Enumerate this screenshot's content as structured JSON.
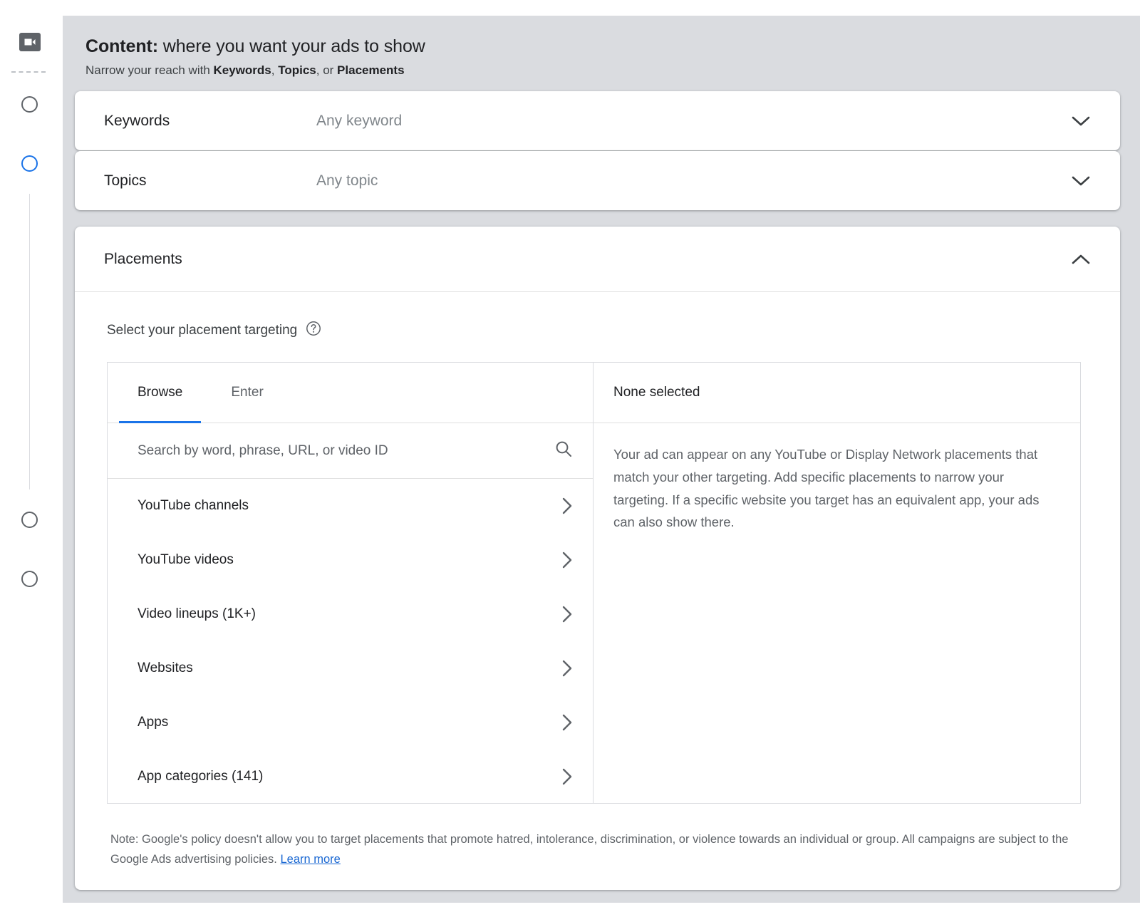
{
  "rail": {
    "brand_icon": "video-camera-icon",
    "steps": [
      {
        "name": "step-1",
        "state": "inactive"
      },
      {
        "name": "step-2",
        "state": "active"
      },
      {
        "name": "step-3",
        "state": "inactive"
      },
      {
        "name": "step-4",
        "state": "inactive"
      }
    ],
    "active_color": "#1a73e8",
    "inactive_color": "#5f6368"
  },
  "section": {
    "title_bold": "Content:",
    "title_rest": " where you want your ads to show",
    "subtitle_prefix": "Narrow your reach with ",
    "subtitle_b1": "Keywords",
    "subtitle_sep1": ", ",
    "subtitle_b2": "Topics",
    "subtitle_sep2": ", or ",
    "subtitle_b3": "Placements"
  },
  "cards": {
    "keywords": {
      "label": "Keywords",
      "value": "Any keyword",
      "chevron": "chevron-down-icon"
    },
    "topics": {
      "label": "Topics",
      "value": "Any topic",
      "chevron": "chevron-down-icon"
    },
    "placements": {
      "label": "Placements",
      "chevron": "chevron-up-icon"
    }
  },
  "placements": {
    "select_label": "Select your placement targeting",
    "help_icon": "help-circle-icon",
    "tabs": [
      {
        "label": "Browse",
        "active": true
      },
      {
        "label": "Enter",
        "active": false
      }
    ],
    "search": {
      "placeholder": "Search by word, phrase, URL, or video ID",
      "value": "",
      "icon": "search-icon"
    },
    "browse_items": [
      {
        "label": "YouTube channels"
      },
      {
        "label": "YouTube videos"
      },
      {
        "label": "Video lineups (1K+)"
      },
      {
        "label": "Websites"
      },
      {
        "label": "Apps"
      },
      {
        "label": "App categories (141)"
      }
    ],
    "selected_panel": {
      "title": "None selected",
      "description": "Your ad can appear on any YouTube or Display Network placements that match your other targeting. Add specific placements to narrow your targeting. If a specific website you target has an equivalent app, your ads can also show there."
    },
    "note": {
      "text": "Note: Google's policy doesn't allow you to target placements that promote hatred, intolerance, discrimination, or violence towards an individual or group. All campaigns are subject to the Google Ads advertising policies. ",
      "link_label": "Learn more"
    }
  },
  "colors": {
    "accent": "#1a73e8",
    "link": "#1967d2",
    "stage_bg": "#dadce0",
    "text_primary": "#202124",
    "text_secondary": "#5f6368"
  }
}
